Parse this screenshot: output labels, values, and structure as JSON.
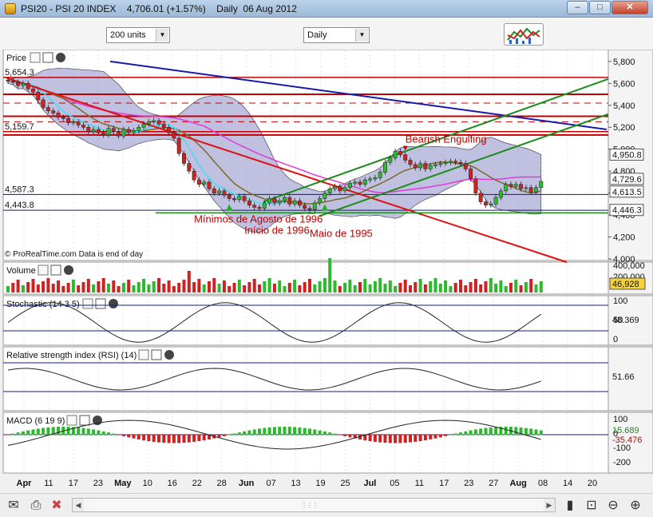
{
  "window": {
    "title": "PSI20 - PSI 20 INDEX",
    "quote": "4,706.01 (+1.57%)",
    "period_label": "Daily",
    "date": "06 Aug 2012",
    "buttons": {
      "minimize": "–",
      "maximize": "□",
      "close": "✕"
    }
  },
  "toolbar": {
    "units_select": "200 units",
    "period_select": "Daily"
  },
  "status": {
    "grip": "⋮⋮⋮"
  },
  "panels": {
    "price": {
      "label": "Price",
      "credit": "© ProRealTime.com  Data is end of day"
    },
    "volume": {
      "label": "Volume"
    },
    "stochastic": {
      "label": "Stochastic (14 3 5)"
    },
    "rsi": {
      "label": "Relative strength index (RSI) (14)"
    },
    "macd": {
      "label": "MACD (6 19 9)"
    }
  },
  "colors": {
    "candle_up": "#2eb82e",
    "candle_down": "#cc2222",
    "bollinger_fill": "#8c8cc8",
    "trend_red": "#e01010",
    "trend_blue": "#1a1aaa",
    "trend_green": "#1a8c1a",
    "ma_magenta": "#e23ad6",
    "ma_olive": "#7a6a2a",
    "ma_cyan": "#3ee0ee"
  },
  "chart_data": {
    "type": "candlestick",
    "x_axis": {
      "labels": [
        "Apr",
        "11",
        "17",
        "23",
        "May",
        "10",
        "16",
        "22",
        "28",
        "Jun",
        "07",
        "13",
        "19",
        "25",
        "Jul",
        "05",
        "11",
        "17",
        "23",
        "27",
        "Aug",
        "08",
        "14",
        "20"
      ],
      "bold_labels": [
        "Apr",
        "May",
        "Jun",
        "Jul",
        "Aug"
      ]
    },
    "price": {
      "y_ticks": [
        4000,
        4200,
        4400,
        4600,
        4800,
        5000,
        5200,
        5400,
        5600,
        5800
      ],
      "y_range": [
        4000,
        5850
      ],
      "level_labels": [
        {
          "text": "5,654.3",
          "value": 5654.3
        },
        {
          "text": "5,159.7",
          "value": 5159.7
        },
        {
          "text": "4,587.3",
          "value": 4587.3
        },
        {
          "text": "4,443.8",
          "value": 4443.8
        }
      ],
      "right_badges": [
        {
          "text": "4,950.8",
          "value": 4950.8
        },
        {
          "text": "4,729.6",
          "value": 4729.6
        },
        {
          "text": "4,613.5",
          "value": 4613.5
        },
        {
          "text": "4,446.3",
          "value": 4446.3
        }
      ],
      "closes": [
        5620,
        5610,
        5580,
        5600,
        5550,
        5520,
        5450,
        5380,
        5350,
        5330,
        5290,
        5280,
        5240,
        5250,
        5220,
        5200,
        5160,
        5180,
        5150,
        5130,
        5190,
        5160,
        5120,
        5180,
        5150,
        5170,
        5200,
        5230,
        5250,
        5260,
        5230,
        5200,
        5150,
        5100,
        4960,
        4870,
        4800,
        4720,
        4680,
        4700,
        4640,
        4600,
        4620,
        4580,
        4550,
        4540,
        4570,
        4530,
        4490,
        4470,
        4460,
        4510,
        4550,
        4510,
        4530,
        4560,
        4500,
        4530,
        4490,
        4460,
        4450,
        4510,
        4550,
        4600,
        4640,
        4660,
        4620,
        4650,
        4690,
        4700,
        4680,
        4720,
        4730,
        4740,
        4790,
        4880,
        4920,
        4980,
        4950,
        4900,
        4860,
        4830,
        4870,
        4820,
        4850,
        4860,
        4870,
        4880,
        4890,
        4880,
        4870,
        4820,
        4730,
        4600,
        4520,
        4490,
        4500,
        4560,
        4620,
        4680,
        4660,
        4680,
        4640,
        4650,
        4610,
        4650,
        4706
      ],
      "annotations": [
        {
          "text": "Bearish Engulfing",
          "index": 79,
          "value": 5060,
          "color": "#c00000"
        },
        {
          "text": "Mínimos de Agosto de 1996",
          "index": 37,
          "value": 4330,
          "color": "#c00000"
        },
        {
          "text": "Início de 1996",
          "index": 47,
          "value": 4230,
          "color": "#c00000"
        },
        {
          "text": "Maio de 1995",
          "index": 60,
          "value": 4200,
          "color": "#c00000"
        }
      ]
    },
    "volume": {
      "y_ticks_labels": [
        "400,000",
        "200,000"
      ],
      "last": "46,928"
    },
    "stochastic": {
      "y_ticks": [
        100,
        50,
        0
      ],
      "last": "48.369"
    },
    "rsi": {
      "last": "51.66"
    },
    "macd": {
      "y_ticks": [
        100,
        0,
        -100,
        -200
      ],
      "signal": "15.689",
      "hist": "-35.476"
    }
  }
}
